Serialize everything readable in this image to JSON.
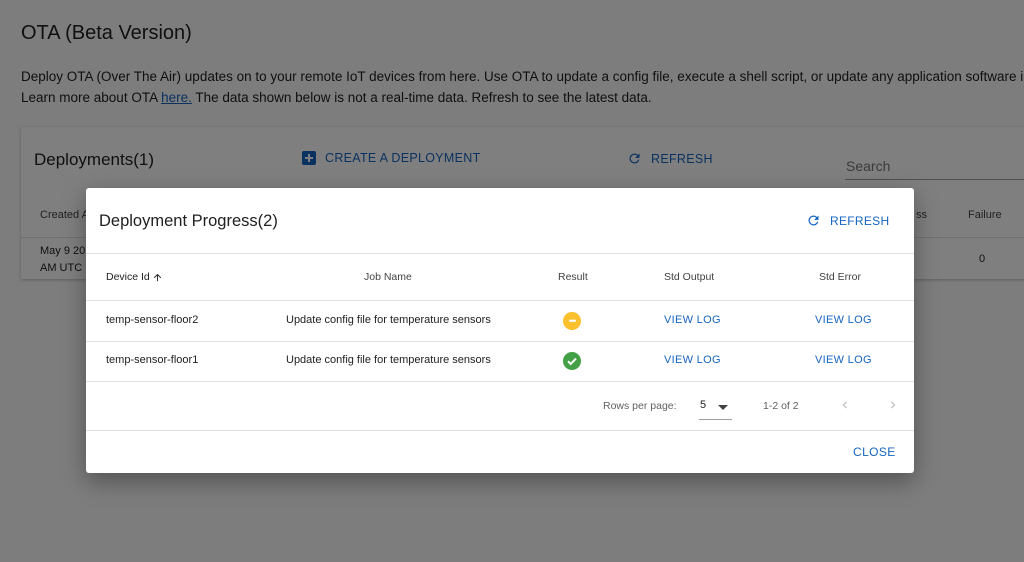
{
  "page": {
    "title": "OTA (Beta Version)",
    "description_line1": "Deploy OTA (Over The Air) updates on to your remote IoT devices from here. Use OTA to update a config file, execute a shell script, or update any application software in you",
    "description_line2_prefix": "Learn more about OTA ",
    "description_link": "here.",
    "description_line2_suffix": " The data shown below is not a real-time data. Refresh to see the latest data."
  },
  "deployments": {
    "title": "Deployments(1)",
    "create_label": "CREATE A DEPLOYMENT",
    "refresh_label": "REFRESH",
    "search_placeholder": "Search",
    "columns": {
      "created_at": "Created At",
      "success": "ss",
      "failure": "Failure"
    },
    "row": {
      "created_line1": "May 9 20",
      "created_line2": "AM UTC",
      "failure": "0"
    }
  },
  "dialog": {
    "title": "Deployment Progress(2)",
    "refresh_label": "REFRESH",
    "columns": {
      "device_id": "Device Id",
      "job_name": "Job Name",
      "result": "Result",
      "std_output": "Std Output",
      "std_error": "Std Error"
    },
    "rows": [
      {
        "device_id": "temp-sensor-floor2",
        "job_name": "Update config file for temperature sensors",
        "result": "pending",
        "std_output": "VIEW LOG",
        "std_error": "VIEW LOG"
      },
      {
        "device_id": "temp-sensor-floor1",
        "job_name": "Update config file for temperature sensors",
        "result": "success",
        "std_output": "VIEW LOG",
        "std_error": "VIEW LOG"
      }
    ],
    "pagination": {
      "rows_per_page_label": "Rows per page:",
      "rows_per_page_value": "5",
      "range": "1-2 of 2"
    },
    "close_label": "CLOSE"
  },
  "colors": {
    "accent": "#1565c0",
    "pending": "#fbc02d",
    "success": "#43a047"
  },
  "icons": {
    "create": "plus-box-icon",
    "refresh": "refresh-icon",
    "sort": "arrow-up-icon",
    "pending": "more-horizontal-circle-icon",
    "success": "check-circle-icon",
    "prev": "chevron-left-icon",
    "next": "chevron-right-icon",
    "dropdown": "caret-down-icon"
  }
}
